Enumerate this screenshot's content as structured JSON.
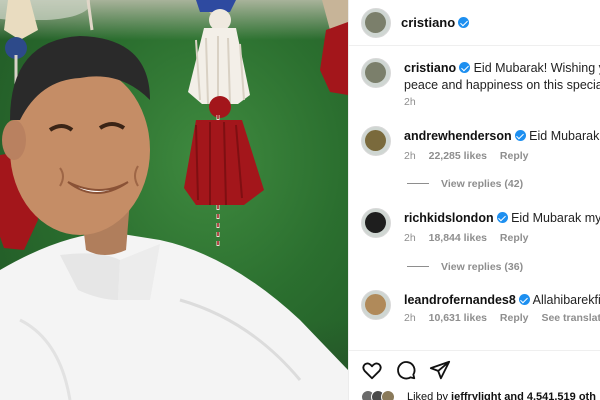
{
  "post": {
    "author": "cristiano",
    "caption_user": "cristiano",
    "caption_text": "Eid Mubarak! Wishing you",
    "caption_text_2": "peace and happiness on this special da",
    "caption_time": "2h"
  },
  "comments": [
    {
      "user": "andrewhenderson",
      "text": "Eid Mubarak",
      "time": "2h",
      "likes": "22,285 likes",
      "reply_label": "Reply",
      "view_replies": "View replies (42)",
      "avatar_color": "#7a6a3c"
    },
    {
      "user": "richkidslondon",
      "text": "Eid Mubarak my bro",
      "time": "2h",
      "likes": "18,844 likes",
      "reply_label": "Reply",
      "view_replies": "View replies (36)",
      "avatar_color": "#1e1e1e"
    },
    {
      "user": "leandrofernandes8",
      "text": "Allahibarekfiek",
      "time": "2h",
      "likes": "10,631 likes",
      "reply_label": "Reply",
      "translate_label": "See translation",
      "avatar_color": "#b08a5a"
    }
  ],
  "footer": {
    "liked_prefix": "Liked by",
    "liked_user": "jeffrylight",
    "liked_suffix": "and 4,541,519 oth"
  },
  "icons": [
    "verified-badge-icon",
    "heart-icon",
    "comment-icon",
    "share-icon"
  ],
  "colors": {
    "verified": "#1d8ff0",
    "meta_text": "#8e8e8e",
    "tassel_red": "#a3161b",
    "photo_green": "#2b6f2f"
  }
}
